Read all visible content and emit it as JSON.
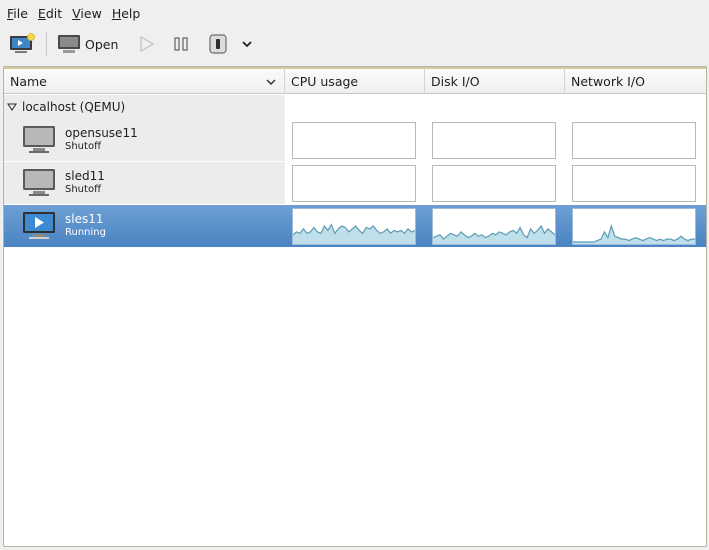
{
  "menu": {
    "file": {
      "mnemonic": "F",
      "rest": "ile"
    },
    "edit": {
      "mnemonic": "E",
      "rest": "dit"
    },
    "view": {
      "mnemonic": "V",
      "rest": "iew"
    },
    "help": {
      "mnemonic": "H",
      "rest": "elp"
    }
  },
  "toolbar": {
    "new_icon": "new-vm-icon",
    "open_label": "Open",
    "run_icon": "play-icon",
    "pause_icon": "pause-icon",
    "shutdown_icon": "power-icon",
    "dropdown_icon": "chevron-down-icon"
  },
  "columns": {
    "name": "Name",
    "cpu": "CPU usage",
    "disk": "Disk I/O",
    "network": "Network I/O"
  },
  "connection": {
    "label": "localhost (QEMU)",
    "expanded": true
  },
  "vms": [
    {
      "name": "opensuse11",
      "status": "Shutoff",
      "running": false,
      "cpu": [],
      "disk": [],
      "net": []
    },
    {
      "name": "sled11",
      "status": "Shutoff",
      "running": false,
      "cpu": [],
      "disk": [],
      "net": []
    },
    {
      "name": "sles11",
      "status": "Running",
      "running": true,
      "selected": true,
      "cpu": [
        0.25,
        0.35,
        0.3,
        0.45,
        0.3,
        0.35,
        0.5,
        0.35,
        0.3,
        0.55,
        0.4,
        0.6,
        0.3,
        0.45,
        0.55,
        0.5,
        0.35,
        0.45,
        0.55,
        0.4,
        0.3,
        0.5,
        0.45,
        0.55,
        0.4,
        0.3,
        0.35,
        0.45,
        0.3,
        0.4,
        0.35,
        0.4,
        0.3,
        0.45,
        0.35,
        0.4
      ],
      "disk": [
        0.15,
        0.2,
        0.25,
        0.1,
        0.2,
        0.3,
        0.25,
        0.2,
        0.35,
        0.25,
        0.15,
        0.2,
        0.3,
        0.2,
        0.25,
        0.15,
        0.2,
        0.3,
        0.25,
        0.35,
        0.3,
        0.25,
        0.35,
        0.4,
        0.3,
        0.5,
        0.25,
        0.15,
        0.45,
        0.3,
        0.4,
        0.55,
        0.3,
        0.45,
        0.35,
        0.25
      ],
      "net": [
        0,
        0,
        0,
        0,
        0,
        0,
        0,
        0.05,
        0.1,
        0.35,
        0.15,
        0.55,
        0.2,
        0.15,
        0.1,
        0.1,
        0.05,
        0.1,
        0.15,
        0.1,
        0.05,
        0.1,
        0.15,
        0.1,
        0.05,
        0.1,
        0.05,
        0.1,
        0.1,
        0.05,
        0.1,
        0.2,
        0.1,
        0.05,
        0.1,
        0.1
      ]
    }
  ],
  "colors": {
    "selection": "#4a84c2",
    "graph_line": "#5b9bb5",
    "graph_fill": "#bfe0ea"
  }
}
